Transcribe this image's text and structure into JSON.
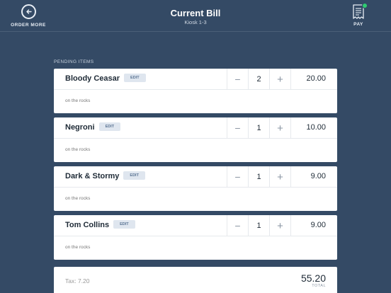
{
  "header": {
    "order_more_label": "ORDER MORE",
    "title": "Current Bill",
    "subtitle": "Kiosk 1-3",
    "pay_label": "PAY"
  },
  "section_label": "PENDING ITEMS",
  "edit_label": "EDIT",
  "items": [
    {
      "name": "Bloody Ceasar",
      "qty": "2",
      "price": "20.00",
      "note": "on the rocks"
    },
    {
      "name": "Negroni",
      "qty": "1",
      "price": "10.00",
      "note": "on the rocks"
    },
    {
      "name": "Dark & Stormy",
      "qty": "1",
      "price": "9.00",
      "note": "on the rocks"
    },
    {
      "name": "Tom Collins",
      "qty": "1",
      "price": "9.00",
      "note": "on the rocks"
    }
  ],
  "summary": {
    "tax": "Tax: 7.20",
    "total": "55.20",
    "total_label": "TOTAL"
  },
  "colors": {
    "background": "#344a65",
    "card": "#ffffff",
    "paid_check": "#2ecc71"
  }
}
